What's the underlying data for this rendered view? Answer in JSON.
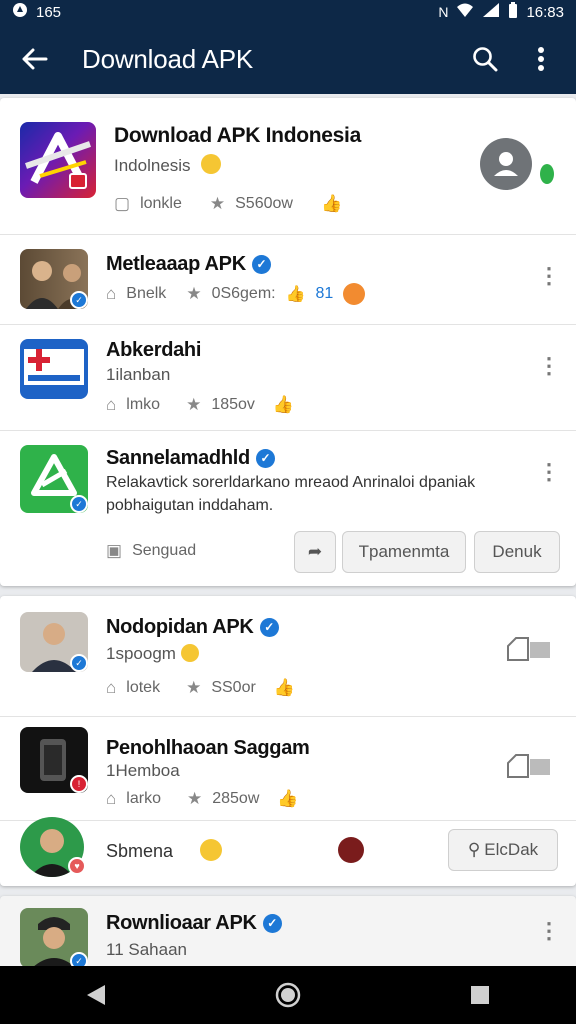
{
  "statusbar": {
    "left_text": "165",
    "time": "16:83",
    "icons": [
      "nfc-icon",
      "wifi-icon",
      "signal-icon",
      "battery-icon"
    ]
  },
  "appbar": {
    "title": "Download APK",
    "icons": {
      "back": "arrow-left-icon",
      "search": "search-icon",
      "menu": "more-vert-icon"
    }
  },
  "featured": {
    "title": "Download APK Indonesia",
    "subtitle": "Indolnesis",
    "stat1": "lonkle",
    "stat2": "S560ow"
  },
  "items": [
    {
      "title": "Metleaaap APK",
      "stat1": "Bnelk",
      "stat2": "0S6gem:",
      "count": "81"
    },
    {
      "title": "Abkerdahi",
      "subtitle": "1ilanban",
      "stat1": "lmko",
      "stat2": "185ov"
    },
    {
      "title": "Sannelamadhld",
      "description": "Relakavtick sorerldarkano mreaod Anrinaloi dpaniak pobhaigutan inddaham.",
      "location": "Senguad",
      "button1": "Tpamenmta",
      "button2": "Denuk"
    }
  ],
  "section2": [
    {
      "title": "Nodopidan APK",
      "subtitle": "1spoogm",
      "stat1": "lotek",
      "stat2": "SS0or"
    },
    {
      "title": "Penohlhaoan Saggam",
      "subtitle": "1Hemboa",
      "stat1": "larko",
      "stat2": "285ow"
    },
    {
      "name": "Sbmena",
      "button": "ElcDak"
    }
  ],
  "section3": {
    "title": "Rownlioaar APK",
    "subtitle": "11 Sahaan"
  },
  "navbar": {
    "icons": [
      "back-triangle-icon",
      "home-circle-icon",
      "recents-square-icon"
    ]
  },
  "colors": {
    "appbar": "#0d2847",
    "verified": "#1d78d6",
    "accent_green": "#2fb24a"
  }
}
